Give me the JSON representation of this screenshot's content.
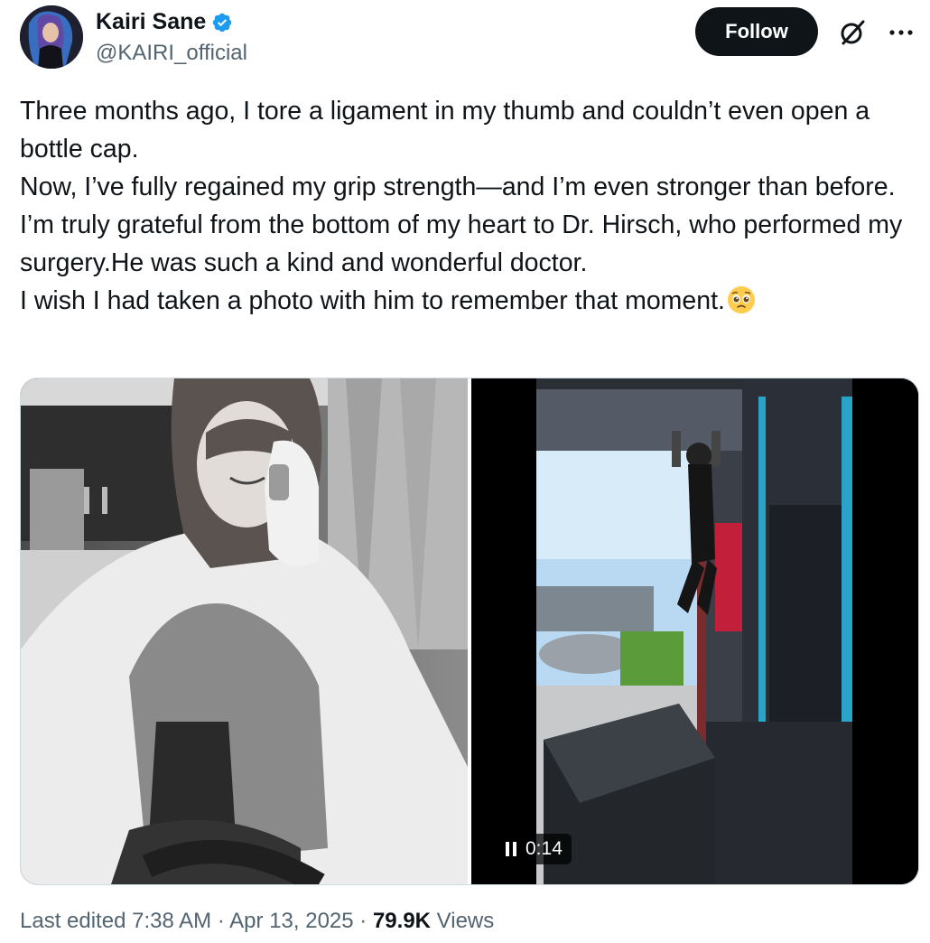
{
  "author": {
    "display_name": "Kairi Sane",
    "handle": "@KAIRI_official",
    "verified": true
  },
  "actions": {
    "follow_label": "Follow",
    "grok_icon": "grok-icon",
    "more_icon": "more-icon"
  },
  "tweet": {
    "lines": [
      "Three months ago, I tore a ligament in my thumb and couldn’t even open a bottle cap.",
      "Now, I’ve fully regained my grip strength—and I’m even stronger than before.",
      "I’m truly grateful from the bottom of my heart to Dr. Hirsch, who performed my surgery.He was such a kind and wonderful doctor.",
      "I wish I had taken a photo with him to remember that moment."
    ],
    "emoji": "pleading-face-emoji"
  },
  "media": {
    "photo_icon": "photo",
    "video": {
      "duration": "0:14",
      "state_icon": "pause-icon"
    }
  },
  "meta": {
    "edited_prefix": "Last edited",
    "time": "7:38 AM",
    "sep": "·",
    "date": "Apr 13, 2025",
    "views_count": "79.9K",
    "views_label": "Views"
  },
  "colors": {
    "text": "#0f1419",
    "secondary": "#536471",
    "verified": "#1d9bf0",
    "button": "#0f1419"
  }
}
